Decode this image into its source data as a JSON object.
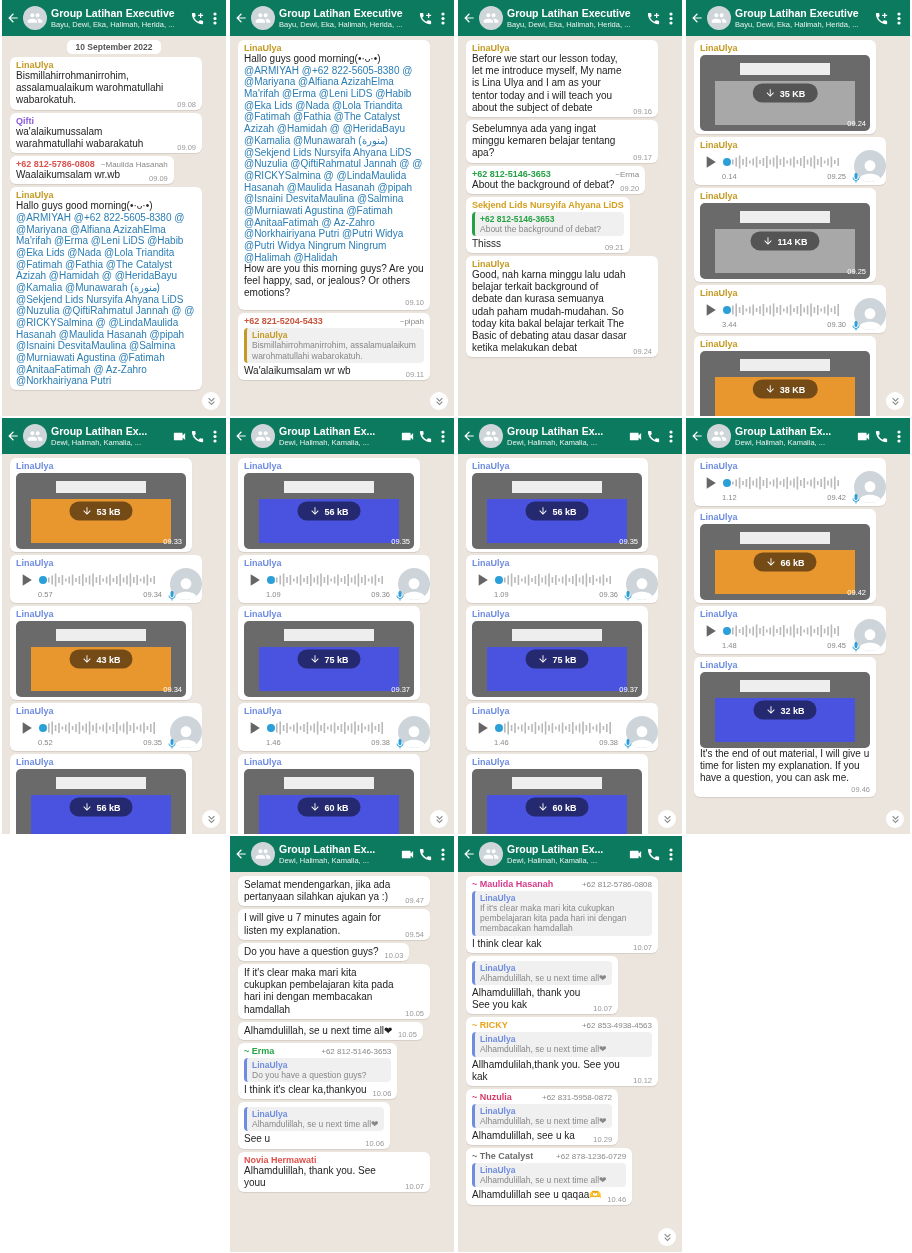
{
  "rows": [
    [
      {
        "title": "Group Latihan Executive",
        "subtitle": "Bayu, Dewi, Eka, Halimah, Herida, ...",
        "actions": [
          {
            "kind": "add-call"
          },
          {
            "kind": "menu"
          }
        ],
        "scroll_down": true,
        "items": [
          {
            "kind": "date",
            "text": "10 September 2022"
          },
          {
            "kind": "text",
            "sender": {
              "name": "LinaUlya",
              "color": "#c49a22"
            },
            "text": "Bismillahirrohmanirrohim, assalamualaikum warohmatullahi wabarokatuh.",
            "time": "09.08"
          },
          {
            "kind": "text",
            "sender": {
              "name": "Qifti",
              "color": "#8a5ad8"
            },
            "text": "wa'alaikumussalam warahmatullahi wabarakatuh",
            "time": "09.09"
          },
          {
            "kind": "text",
            "sender": {
              "name": "+62 812-5786-0808",
              "color": "#d9534f",
              "aside": "~Maulida Hasanah"
            },
            "text": "Waalaikumsalam wr.wb",
            "time": "09.09"
          },
          {
            "kind": "text",
            "sender": {
              "name": "LinaUlya",
              "color": "#c49a22"
            },
            "lead": "Hallo guys good morning(•·ᴗ·•)",
            "mentions": "@ARMIYAH @+62 822-5605-8380 @ @Mariyana @Alfiana AzizahElma Ma'rifah @Erma @Leni LiDS @Habib @Eka Lids @Nada @Lola Triandita @Fatimah @Fathia @The Catalyst Azizah @Hamidah @ @HeridaBayu @Kamalia @Munawarah (منورة) @Sekjend Lids Nursyifa Ahyana LiDS @Nuzulia @QiftiRahmatul Jannah @ @ @RICKYSalmina @ @LindaMaulida Hasanah @Maulida Hasanah @pipah @Isnaini DesvitaMaulina @Salmina @Murniawati Agustina @Fatimah @AnitaaFatimah @ Az-Zahro @Norkhairiyana Putri"
          }
        ]
      },
      {
        "title": "Group Latihan Executive",
        "subtitle": "Bayu, Dewi, Eka, Halimah, Herida, ...",
        "actions": [
          {
            "kind": "add-call"
          },
          {
            "kind": "menu"
          }
        ],
        "scroll_down": true,
        "items": [
          {
            "kind": "text",
            "sender": {
              "name": "LinaUlya",
              "color": "#c49a22"
            },
            "lead": "Hallo guys good morning(•·ᴗ·•)",
            "mentions": "@ARMIYAH @+62 822-5605-8380 @ @Mariyana @Alfiana AzizahElma Ma'rifah @Erma @Leni LiDS @Habib @Eka Lids @Nada @Lola Triandita @Fatimah @Fathia @The Catalyst Azizah @Hamidah @ @HeridaBayu @Kamalia @Munawarah (منورة) @Sekjend Lids Nursyifa Ahyana LiDS @Nuzulia @QiftiRahmatul Jannah @ @ @RICKYSalmina @ @LindaMaulida Hasanah @Maulida Hasanah @pipah @Isnaini DesvitaMaulina @Salmina @Murniawati Agustina @Fatimah @AnitaaFatimah @ Az-Zahro @Norkhairiyana Putri @Putri Widya @Putri Widya Ningrum Ningrum @Halimah @Halidah",
            "text": "How are you this morning guys? Are you feel happy, sad, or jealous? Or others emotions?",
            "time": "09.10"
          },
          {
            "kind": "text",
            "sender": {
              "name": "+62 821-5204-5433",
              "color": "#c8553d",
              "aside": "~pipah"
            },
            "quote": {
              "name": "LinaUlya",
              "color": "#c49a22",
              "text": "Bismillahirrohmanirrohim, assalamualaikum warohmatullahi wabarokatuh."
            },
            "text": "Wa'alaikumsalam wr wb",
            "time": "09.11"
          }
        ]
      },
      {
        "title": "Group Latihan Executive",
        "subtitle": "Bayu, Dewi, Eka, Halimah, Herida, ...",
        "actions": [
          {
            "kind": "add-call"
          },
          {
            "kind": "menu"
          }
        ],
        "scroll_down": false,
        "items": [
          {
            "kind": "text",
            "sender": {
              "name": "LinaUlya",
              "color": "#c49a22"
            },
            "text": "Before we start our lesson today, let me introduce myself, My name is Lina Ulya and I am as your tentor today and i will teach you about the subject of debate",
            "time": "09.16"
          },
          {
            "kind": "text",
            "text": "Sebelumnya ada yang ingat minggu kemaren belajar tentang apa?",
            "time": "09.17"
          },
          {
            "kind": "text",
            "sender": {
              "name": "+62 812-5146-3653",
              "color": "#25a244",
              "aside": "~Erma"
            },
            "text": "About the background of debat?",
            "time": "09.20"
          },
          {
            "kind": "text",
            "sender": {
              "name": "Sekjend Lids Nursyifa Ahyana LiDS",
              "color": "#d4a020"
            },
            "quote": {
              "name": "+62 812-5146-3653",
              "color": "#25a244",
              "text": "About the background of debat?"
            },
            "text": "Thisss",
            "time": "09.21"
          },
          {
            "kind": "text",
            "sender": {
              "name": "LinaUlya",
              "color": "#c49a22"
            },
            "text": "Good, nah karna minggu lalu udah belajar terkait background of debate dan kurasa semuanya udah paham mudah-mudahan. So today kita bakal belajar terkait The Basic of debating atau dasar dasar ketika melakukan debat",
            "time": "09.24"
          }
        ]
      },
      {
        "title": "Group Latihan Executive",
        "subtitle": "Bayu, Dewi, Eka, Halimah, Herida, ...",
        "actions": [
          {
            "kind": "add-call"
          },
          {
            "kind": "menu"
          }
        ],
        "scroll_down": true,
        "items": [
          {
            "kind": "image",
            "sender": {
              "name": "LinaUlya",
              "color": "#c49a22"
            },
            "color": "#a8a8a8",
            "size": "35 KB",
            "time": "09.24"
          },
          {
            "kind": "voice",
            "sender": {
              "name": "LinaUlya",
              "color": "#c49a22"
            },
            "duration": "0.14",
            "time": "09.25"
          },
          {
            "kind": "image",
            "sender": {
              "name": "LinaUlya",
              "color": "#c49a22"
            },
            "color": "#a8a8a8",
            "size": "114 KB",
            "time": "09.25"
          },
          {
            "kind": "voice",
            "sender": {
              "name": "LinaUlya",
              "color": "#c49a22"
            },
            "duration": "3.44",
            "time": "09.30"
          },
          {
            "kind": "image",
            "sender": {
              "name": "LinaUlya",
              "color": "#c49a22"
            },
            "color": "#e8962e",
            "size": "38 KB"
          }
        ]
      }
    ],
    [
      {
        "title": "Group Latihan Ex...",
        "subtitle": "Dewi, Halimah, Kamalia, ...",
        "actions": [
          {
            "kind": "video"
          },
          {
            "kind": "call"
          },
          {
            "kind": "menu"
          }
        ],
        "scroll_down": true,
        "items": [
          {
            "kind": "image",
            "sender": {
              "name": "LinaUlya",
              "color": "#6f8de0"
            },
            "color": "#e8962e",
            "size": "53 kB",
            "time": "09.33"
          },
          {
            "kind": "voice",
            "sender": {
              "name": "LinaUlya",
              "color": "#6f8de0"
            },
            "duration": "0.57",
            "time": "09.34"
          },
          {
            "kind": "image",
            "sender": {
              "name": "LinaUlya",
              "color": "#6f8de0"
            },
            "color": "#e8962e",
            "size": "43 kB",
            "time": "09.34"
          },
          {
            "kind": "voice",
            "sender": {
              "name": "LinaUlya",
              "color": "#6f8de0"
            },
            "duration": "0.52",
            "time": "09.35"
          },
          {
            "kind": "image",
            "sender": {
              "name": "LinaUlya",
              "color": "#6f8de0"
            },
            "color": "#4a52e0",
            "size": "56 kB"
          }
        ]
      },
      {
        "title": "Group Latihan Ex...",
        "subtitle": "Dewi, Halimah, Kamalia, ...",
        "actions": [
          {
            "kind": "video"
          },
          {
            "kind": "call"
          },
          {
            "kind": "menu"
          }
        ],
        "scroll_down": true,
        "items": [
          {
            "kind": "image",
            "sender": {
              "name": "LinaUlya",
              "color": "#6f8de0"
            },
            "color": "#4a52e0",
            "size": "56 kB",
            "time": "09.35"
          },
          {
            "kind": "voice",
            "sender": {
              "name": "LinaUlya",
              "color": "#6f8de0"
            },
            "duration": "1.09",
            "time": "09.36"
          },
          {
            "kind": "image",
            "sender": {
              "name": "LinaUlya",
              "color": "#6f8de0"
            },
            "color": "#4a52e0",
            "size": "75 kB",
            "time": "09.37"
          },
          {
            "kind": "voice",
            "sender": {
              "name": "LinaUlya",
              "color": "#6f8de0"
            },
            "duration": "1.46",
            "time": "09.38"
          },
          {
            "kind": "image",
            "sender": {
              "name": "LinaUlya",
              "color": "#6f8de0"
            },
            "color": "#4a52e0",
            "size": "60 kB"
          }
        ]
      },
      {
        "title": "Group Latihan Ex...",
        "subtitle": "Dewi, Halimah, Kamalia, ...",
        "actions": [
          {
            "kind": "video"
          },
          {
            "kind": "call"
          },
          {
            "kind": "menu"
          }
        ],
        "scroll_down": true,
        "items": [
          {
            "kind": "image",
            "sender": {
              "name": "LinaUlya",
              "color": "#6f8de0"
            },
            "color": "#4a52e0",
            "size": "56 kB",
            "time": "09.35"
          },
          {
            "kind": "voice",
            "sender": {
              "name": "LinaUlya",
              "color": "#6f8de0"
            },
            "duration": "1.09",
            "time": "09.36"
          },
          {
            "kind": "image",
            "sender": {
              "name": "LinaUlya",
              "color": "#6f8de0"
            },
            "color": "#4a52e0",
            "size": "75 kB",
            "time": "09.37"
          },
          {
            "kind": "voice",
            "sender": {
              "name": "LinaUlya",
              "color": "#6f8de0"
            },
            "duration": "1.46",
            "time": "09.38"
          },
          {
            "kind": "image",
            "sender": {
              "name": "LinaUlya",
              "color": "#6f8de0"
            },
            "color": "#4a52e0",
            "size": "60 kB"
          }
        ]
      },
      {
        "title": "Group Latihan Ex...",
        "subtitle": "Dewi, Halimah, Kamalia, ...",
        "actions": [
          {
            "kind": "video"
          },
          {
            "kind": "call"
          },
          {
            "kind": "menu"
          }
        ],
        "scroll_down": true,
        "items": [
          {
            "kind": "voice",
            "sender": {
              "name": "LinaUlya",
              "color": "#6f8de0"
            },
            "duration": "1.12",
            "time": "09.42"
          },
          {
            "kind": "image",
            "sender": {
              "name": "LinaUlya",
              "color": "#6f8de0"
            },
            "color": "#e8962e",
            "size": "66 kB",
            "time": "09.42"
          },
          {
            "kind": "voice",
            "sender": {
              "name": "LinaUlya",
              "color": "#6f8de0"
            },
            "duration": "1.48",
            "time": "09.45"
          },
          {
            "kind": "image",
            "sender": {
              "name": "LinaUlya",
              "color": "#6f8de0"
            },
            "color": "#4a52e0",
            "size": "32 kB",
            "caption": "It's the end of out material, I will give u time for listen my explanation. If you have a question, you can ask me.",
            "time": "09.46"
          }
        ]
      }
    ],
    [
      {
        "title": "Group Latihan Ex...",
        "subtitle": "Dewi, Halimah, Kamalia, ...",
        "actions": [
          {
            "kind": "video"
          },
          {
            "kind": "call"
          },
          {
            "kind": "menu"
          }
        ],
        "scroll_down": false,
        "items": [
          {
            "kind": "text",
            "text": "Selamat mendengarkan, jika ada pertanyaan silahkan ajukan ya :)",
            "time": "09.47"
          },
          {
            "kind": "text",
            "text": "I will give u 7 minutes again for listen my explanation.",
            "time": "09.54"
          },
          {
            "kind": "text",
            "text": "Do you have a question guys?",
            "time": "10.03"
          },
          {
            "kind": "text",
            "text": "If it's clear maka mari kita cukupkan pembelajaran kita pada hari ini dengan membacakan hamdallah",
            "time": "10.05"
          },
          {
            "kind": "text",
            "text": "Alhamdulillah, se u next time all❤",
            "time": "10.05"
          },
          {
            "kind": "text",
            "sender": {
              "name": "~ Erma",
              "color": "#25a244",
              "aside": "+62 812-5146-3653"
            },
            "quote": {
              "name": "LinaUlya",
              "color": "#6f8de0",
              "text": "Do you have a question guys?"
            },
            "text": "I think it's clear ka,thankyou",
            "time": "10.06"
          },
          {
            "kind": "text",
            "quote": {
              "name": "LinaUlya",
              "color": "#6f8de0",
              "text": "Alhamdulillah, se u next time all❤"
            },
            "text": "See u",
            "time": "10.06"
          },
          {
            "kind": "text",
            "sender": {
              "name": "Novia Hermawati",
              "color": "#e0504a"
            },
            "text": "Alhamdulillah, thank you. See youu",
            "time": "10.07"
          }
        ]
      },
      {
        "title": "Group Latihan Ex...",
        "subtitle": "Dewi, Halimah, Kamalia, ...",
        "actions": [
          {
            "kind": "video"
          },
          {
            "kind": "call"
          },
          {
            "kind": "menu"
          }
        ],
        "scroll_down": true,
        "items": [
          {
            "kind": "text",
            "sender": {
              "name": "~ Maulida Hasanah",
              "color": "#d63a8a",
              "aside": "+62 812-5786-0808"
            },
            "quote": {
              "name": "LinaUlya",
              "color": "#6f8de0",
              "text": "If it's clear maka mari kita cukupkan pembelajaran kita pada hari ini dengan membacakan hamdallah"
            },
            "text": "I think clear kak",
            "time": "10.07"
          },
          {
            "kind": "text",
            "quote": {
              "name": "LinaUlya",
              "color": "#6f8de0",
              "text": "Alhamdulillah, se u next time all❤"
            },
            "text": "Alhamdulillah, thank you\nSee you kak",
            "time": "10.07"
          },
          {
            "kind": "text",
            "sender": {
              "name": "~ RICKY",
              "color": "#e8a317",
              "aside": "+62 853-4938-4563"
            },
            "quote": {
              "name": "LinaUlya",
              "color": "#6f8de0",
              "text": "Alhamdulillah, se u next time all❤"
            },
            "text": "Allhamdulilah,thank you. See you kak",
            "time": "10.12"
          },
          {
            "kind": "text",
            "sender": {
              "name": "~ Nuzulia",
              "color": "#d63a6a",
              "aside": "+62 831-5958-0872"
            },
            "quote": {
              "name": "LinaUlya",
              "color": "#6f8de0",
              "text": "Alhamdulillah, se u next time all❤"
            },
            "text": "Alhamdulillah, see u ka",
            "time": "10.29"
          },
          {
            "kind": "text",
            "sender": {
              "name": "~ The Catalyst",
              "color": "#6b6b6b",
              "aside": "+62 878-1236-0729"
            },
            "quote": {
              "name": "LinaUlya",
              "color": "#6f8de0",
              "text": "Alhamdulillah, se u next time all❤"
            },
            "text": "Alhamdulillah see u qaqaa🫶",
            "time": "10.46"
          }
        ]
      }
    ]
  ]
}
